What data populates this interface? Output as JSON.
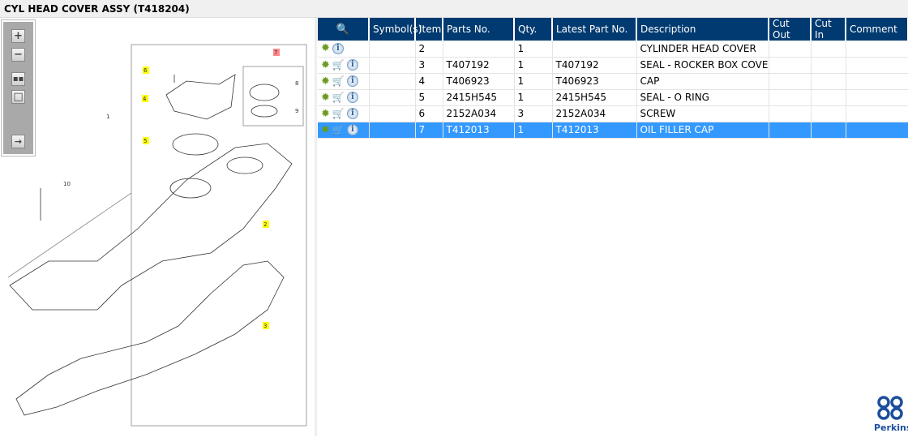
{
  "title": "CYL HEAD COVER ASSY (T418204)",
  "toolbar": {
    "zoom_in": "zoom-in",
    "zoom_out": "zoom-out",
    "fit": "fit",
    "window": "window",
    "export": "export"
  },
  "diagram": {
    "callouts": [
      "1",
      "2",
      "3",
      "4",
      "5",
      "6",
      "7",
      "8",
      "9",
      "10"
    ]
  },
  "table": {
    "headers": [
      "Symbol(s)",
      "Item",
      "Parts No.",
      "Qty.",
      "Latest Part No.",
      "Description",
      "Cut Out",
      "Cut In",
      "Comment"
    ],
    "rows": [
      {
        "item": "2",
        "part": "",
        "qty": "1",
        "latest": "",
        "desc": "CYLINDER HEAD COVER",
        "cart": false,
        "selected": false
      },
      {
        "item": "3",
        "part": "T407192",
        "qty": "1",
        "latest": "T407192",
        "desc": "SEAL - ROCKER BOX COVER",
        "cart": true,
        "selected": false
      },
      {
        "item": "4",
        "part": "T406923",
        "qty": "1",
        "latest": "T406923",
        "desc": "CAP",
        "cart": true,
        "selected": false
      },
      {
        "item": "5",
        "part": "2415H545",
        "qty": "1",
        "latest": "2415H545",
        "desc": "SEAL - O RING",
        "cart": true,
        "selected": false
      },
      {
        "item": "6",
        "part": "2152A034",
        "qty": "3",
        "latest": "2152A034",
        "desc": "SCREW",
        "cart": true,
        "selected": false
      },
      {
        "item": "7",
        "part": "T412013",
        "qty": "1",
        "latest": "T412013",
        "desc": "OIL FILLER CAP",
        "cart": true,
        "selected": true
      }
    ]
  },
  "brand": {
    "name": "Perkins",
    "color": "#1c4f9c"
  },
  "colors": {
    "header": "#003a70",
    "selected": "#3399ff",
    "highlight": "#ffff00"
  }
}
